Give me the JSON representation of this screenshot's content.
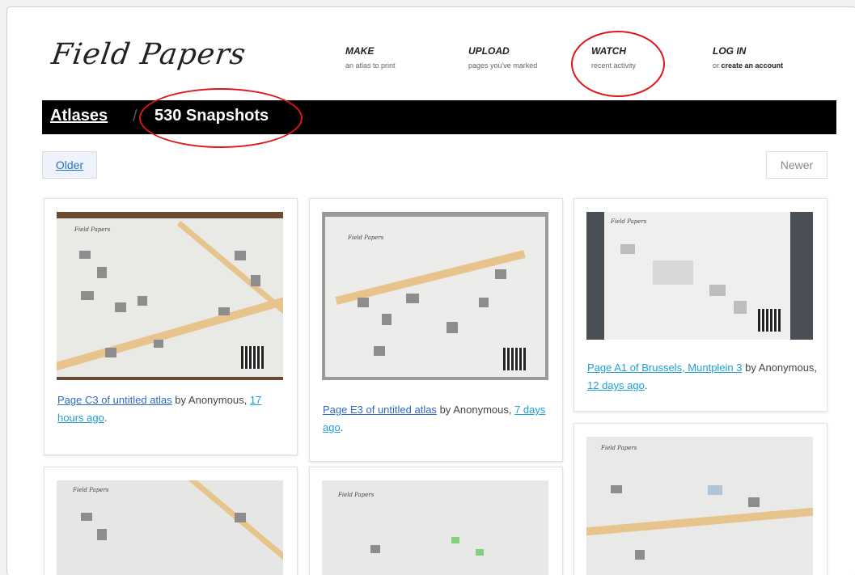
{
  "brand": {
    "logo_text": "Field Papers"
  },
  "nav": [
    {
      "title": "MAKE",
      "sub": "an atlas to print"
    },
    {
      "title": "UPLOAD",
      "sub": "pages you've marked"
    },
    {
      "title": "WATCH",
      "sub": "recent activity"
    },
    {
      "title": "LOG IN",
      "sub_prefix": "or",
      "sub_bold": "create an account"
    }
  ],
  "titlebar": {
    "breadcrumb": "Atlases",
    "separator": "/",
    "title": "530 Snapshots"
  },
  "pager": {
    "older": "Older",
    "newer": "Newer"
  },
  "snapshots": [
    {
      "link": "Page C3 of untitled atlas",
      "by": "by",
      "author": "Anonymous,",
      "time": "17 hours ago",
      "end": "."
    },
    {
      "link": "Page E3 of untitled atlas",
      "by": "by",
      "author": "Anonymous,",
      "time": "7 days ago",
      "end": "."
    },
    {
      "link": "Page A1 of Brussels, Muntplein 3",
      "by": "by",
      "author": "Anonymous,",
      "time": "12 days ago",
      "end": "."
    }
  ],
  "thumb_labels": {
    "mini_logo": "Field Papers"
  },
  "colors": {
    "highlight_circle": "#e0141b",
    "titlebar_bg": "#000000",
    "link": "#2e6bc4"
  }
}
